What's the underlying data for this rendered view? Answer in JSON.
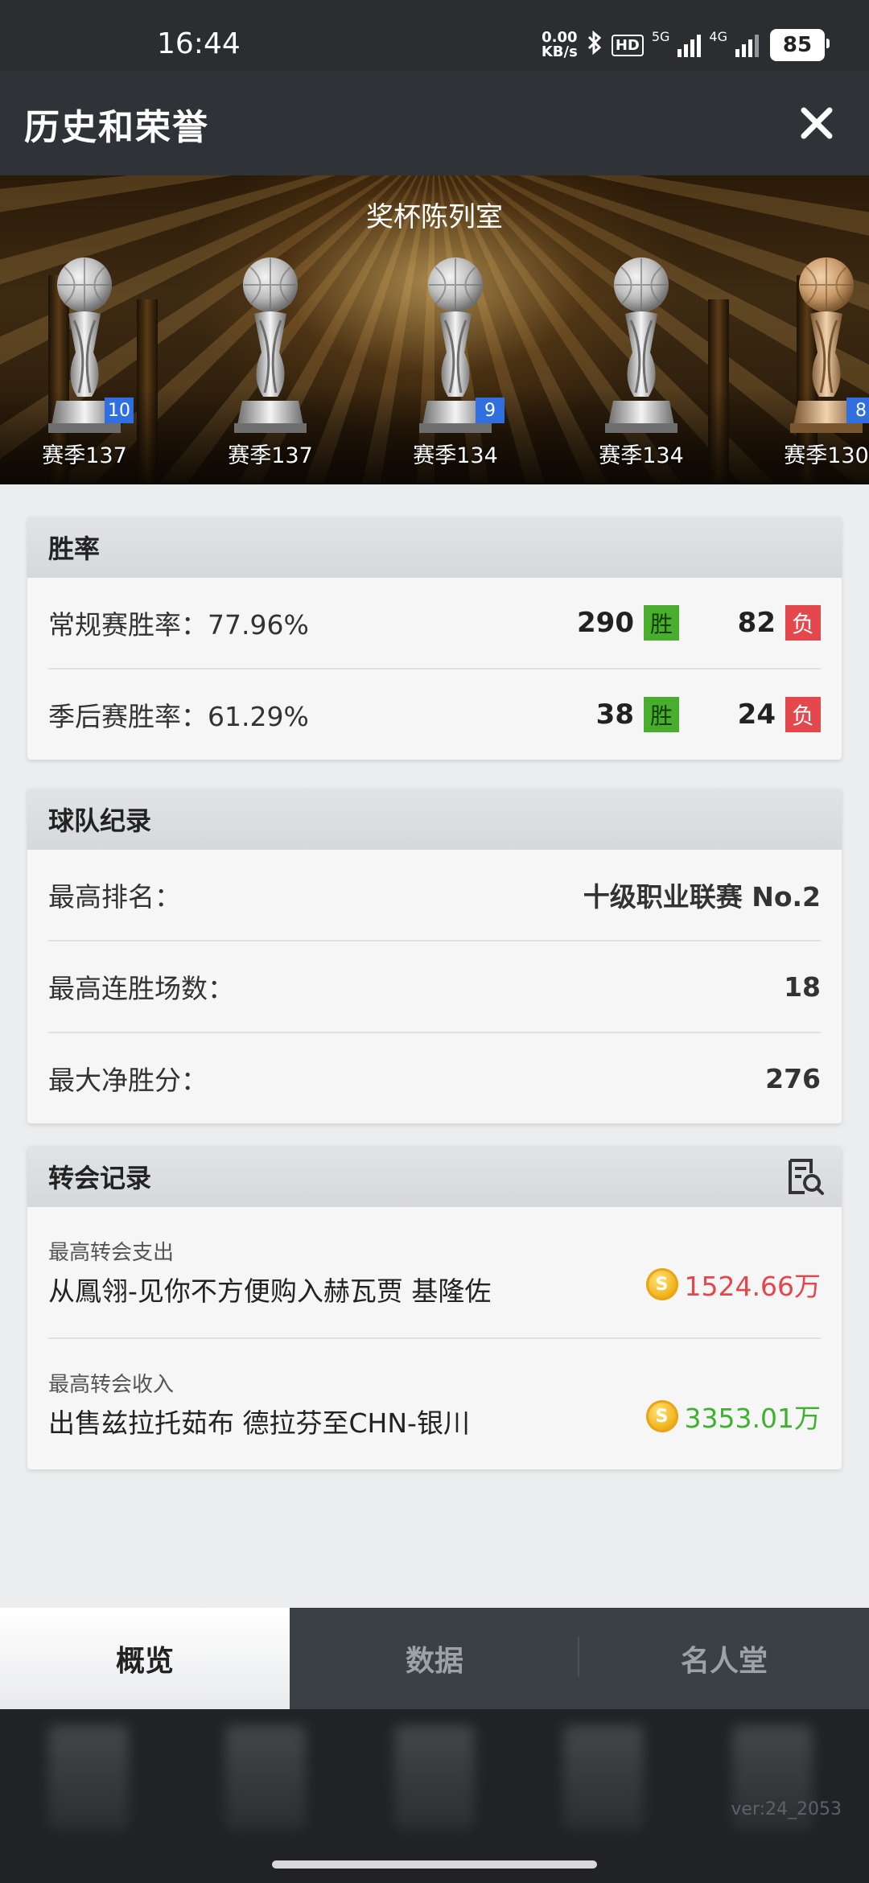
{
  "status_bar": {
    "time": "16:44",
    "net_speed_value": "0.00",
    "net_speed_unit": "KB/s",
    "hd_label": "HD",
    "signal1": "5G",
    "signal2": "4G",
    "battery": "85"
  },
  "header": {
    "title": "历史和荣誉",
    "close_icon": "close-icon"
  },
  "trophy_room": {
    "title": "奖杯陈列室",
    "trophies": [
      {
        "season": "赛季137",
        "badge": "10",
        "color": "silver"
      },
      {
        "season": "赛季137",
        "badge": "",
        "color": "silver"
      },
      {
        "season": "赛季134",
        "badge": "9",
        "color": "silver"
      },
      {
        "season": "赛季134",
        "badge": "",
        "color": "silver"
      },
      {
        "season": "赛季130",
        "badge": "8",
        "color": "bronze"
      }
    ]
  },
  "win_rate": {
    "title": "胜率",
    "win_tag": "胜",
    "loss_tag": "负",
    "rows": [
      {
        "label": "常规赛胜率：77.96%",
        "wins": "290",
        "losses": "82"
      },
      {
        "label": "季后赛胜率：61.29%",
        "wins": "38",
        "losses": "24"
      }
    ]
  },
  "team_record": {
    "title": "球队纪录",
    "rows": [
      {
        "label": "最高排名：",
        "value": "十级职业联赛 No.2"
      },
      {
        "label": "最高连胜场数：",
        "value": "18"
      },
      {
        "label": "最大净胜分：",
        "value": "276"
      }
    ]
  },
  "transfer_record": {
    "title": "转会记录",
    "coin_symbol": "S",
    "rows": [
      {
        "label": "最高转会支出",
        "desc": "从鳳翎-见你不方便购入赫瓦贾 基隆佐",
        "amount": "1524.66万",
        "kind": "spend"
      },
      {
        "label": "最高转会收入",
        "desc": "出售兹拉托茹布 德拉芬至CHN-银川",
        "amount": "3353.01万",
        "kind": "earn"
      }
    ]
  },
  "tabs": [
    {
      "label": "概览",
      "active": true
    },
    {
      "label": "数据",
      "active": false
    },
    {
      "label": "名人堂",
      "active": false
    }
  ],
  "version": "ver:24_2053"
}
